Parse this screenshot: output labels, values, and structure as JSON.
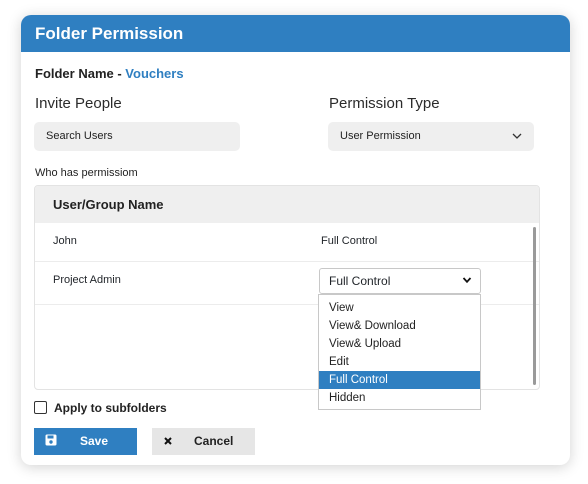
{
  "dialog": {
    "title": "Folder Permission"
  },
  "folder": {
    "label": "Folder Name - ",
    "value": "Vouchers"
  },
  "invite": {
    "label": "Invite People",
    "placeholder": "Search Users"
  },
  "permission_type": {
    "label": "Permission Type",
    "selected": "User Permission"
  },
  "who_label": "Who has permissiom",
  "table": {
    "header": "User/Group Name",
    "rows": [
      {
        "name": "John",
        "permission": "Full Control"
      },
      {
        "name": "Project Admin",
        "permission": "Full Control"
      }
    ]
  },
  "dropdown": {
    "options": [
      "View",
      "View& Download",
      "View& Upload",
      "Edit",
      "Full Control",
      "Hidden"
    ],
    "selected_index": 4
  },
  "apply": {
    "label": "Apply to subfolders",
    "checked": false
  },
  "buttons": {
    "save": "Save",
    "cancel": "Cancel"
  },
  "colors": {
    "accent": "#2f7fc1",
    "field_bg": "#efefef"
  },
  "icons": {
    "save": "floppy-disk-icon",
    "cancel": "close-icon",
    "select": "chevron-down-icon"
  }
}
